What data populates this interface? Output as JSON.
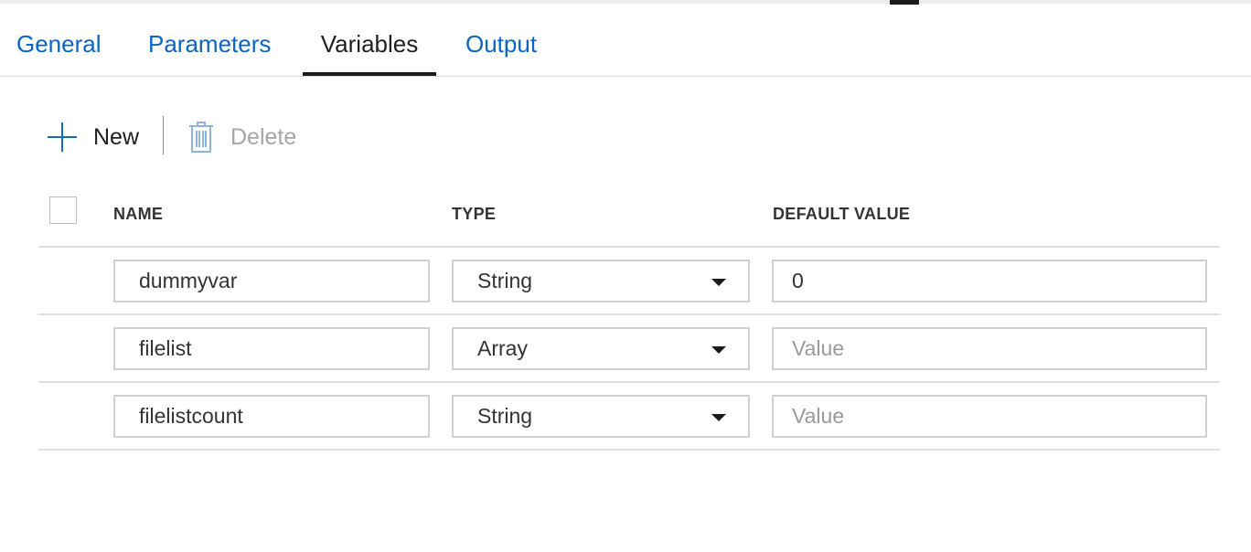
{
  "tabs": [
    {
      "label": "General",
      "active": false
    },
    {
      "label": "Parameters",
      "active": false
    },
    {
      "label": "Variables",
      "active": true
    },
    {
      "label": "Output",
      "active": false
    }
  ],
  "toolbar": {
    "new_label": "New",
    "delete_label": "Delete"
  },
  "columns": {
    "name": "NAME",
    "type": "TYPE",
    "default_value": "DEFAULT VALUE"
  },
  "variables": [
    {
      "name": "dummyvar",
      "type": "String",
      "default_value": "0",
      "placeholder": "Value"
    },
    {
      "name": "filelist",
      "type": "Array",
      "default_value": "",
      "placeholder": "Value"
    },
    {
      "name": "filelistcount",
      "type": "String",
      "default_value": "",
      "placeholder": "Value"
    }
  ],
  "icons": {
    "new": "plus-icon",
    "delete": "trash-icon",
    "type_dropdown": "caret-down-icon"
  },
  "colors": {
    "accent": "#0b65c2",
    "active_tab": "#1f1f1f",
    "disabled": "#a6a6a6"
  }
}
